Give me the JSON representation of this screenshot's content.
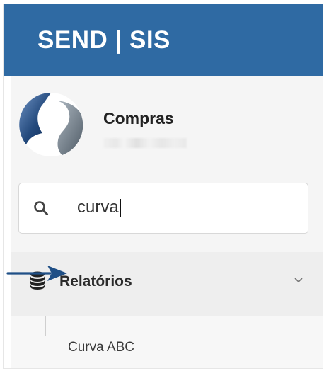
{
  "app": {
    "brand": "SEND | SIS"
  },
  "profile": {
    "title": "Compras",
    "subtitle_blurred": true
  },
  "search": {
    "value": "curva",
    "icon": "search-icon"
  },
  "menu": {
    "section": {
      "label": "Relatórios",
      "icon": "database-icon",
      "expanded": true
    },
    "items": [
      {
        "label": "Curva ABC"
      }
    ]
  },
  "annotation": {
    "icon": "arrow-right-icon",
    "color": "#1f4f86"
  },
  "colors": {
    "header": "#2f6aa3",
    "sidebar": "#f5f5f5"
  }
}
